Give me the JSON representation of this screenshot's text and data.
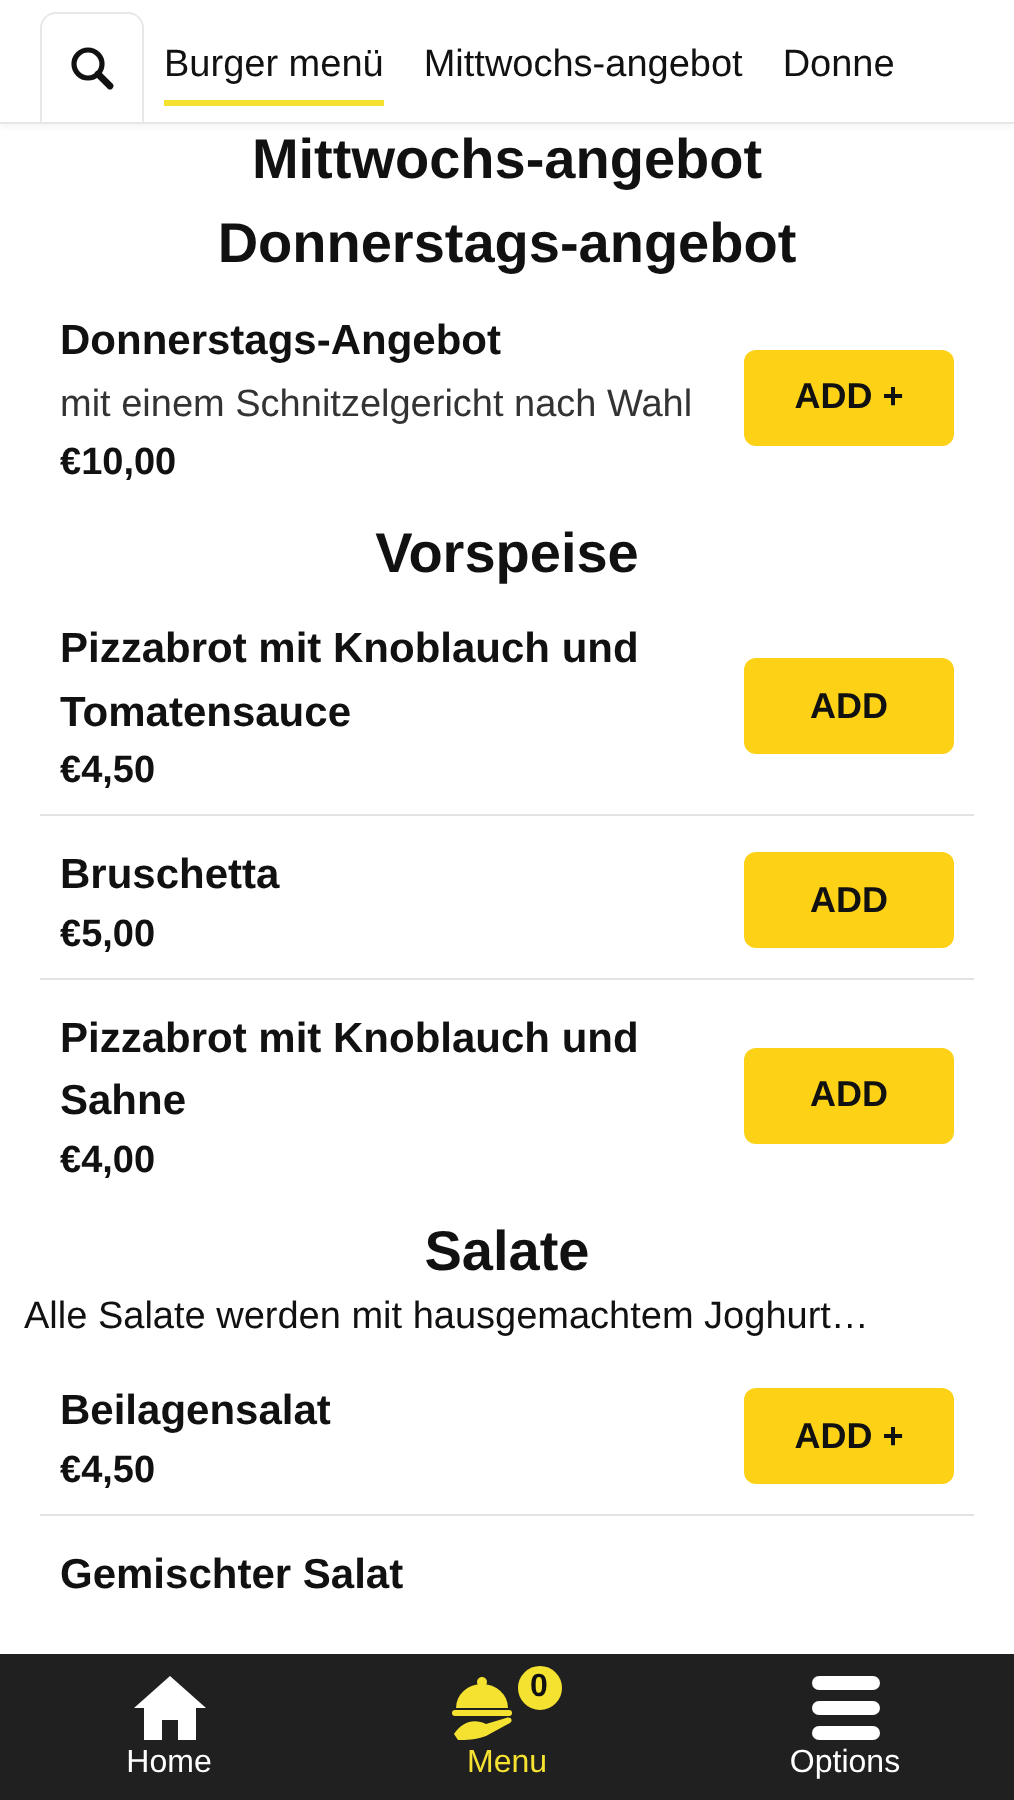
{
  "tabs": [
    {
      "label": "Burger menü",
      "selected": true
    },
    {
      "label": "Mittwochs-angebot",
      "selected": false
    },
    {
      "label": "Donne",
      "selected": false
    }
  ],
  "sections": [
    {
      "title": "Mittwochs-angebot"
    },
    {
      "title": "Donnerstags-angebot",
      "items": [
        {
          "name": "Donnerstags-Angebot",
          "description": "mit einem Schnitzelgericht nach Wahl",
          "price": "€10,00",
          "button": "ADD +"
        }
      ]
    },
    {
      "title": "Vorspeise",
      "items": [
        {
          "name": "Pizzabrot mit Knoblauch und Tomatensauce",
          "price": "€4,50",
          "button": "ADD"
        },
        {
          "name": "Bruschetta",
          "price": "€5,00",
          "button": "ADD"
        },
        {
          "name": "Pizzabrot mit Knoblauch und Sahne",
          "price": "€4,00",
          "button": "ADD"
        }
      ]
    },
    {
      "title": "Salate",
      "note": "Alle Salate werden mit hausgemachtem Joghurt…",
      "items": [
        {
          "name": "Beilagensalat",
          "price": "€4,50",
          "button": "ADD +"
        },
        {
          "name": "Gemischter Salat"
        }
      ]
    }
  ],
  "nav": [
    {
      "label": "Home",
      "kind": "home",
      "selected": false
    },
    {
      "label": "Menu",
      "kind": "menu",
      "selected": true,
      "badge": "0"
    },
    {
      "label": "Options",
      "kind": "options",
      "selected": false
    }
  ]
}
